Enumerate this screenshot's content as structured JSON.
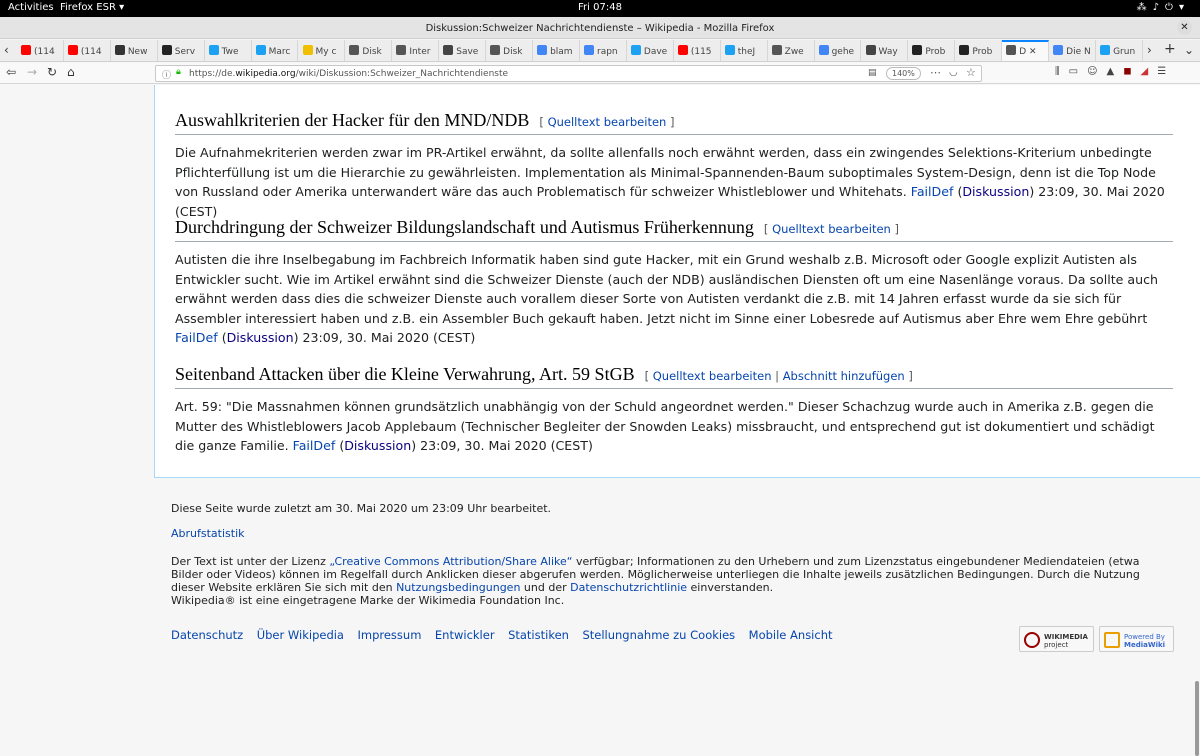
{
  "system": {
    "activities": "Activities",
    "app_name": "Firefox ESR ▾",
    "clock": "Fri 07:48"
  },
  "window": {
    "title": "Diskussion:Schweizer Nachrichtendienste – Wikipedia - Mozilla Firefox"
  },
  "tabs": [
    {
      "label": "(114",
      "color": "#ff0000"
    },
    {
      "label": "(114",
      "color": "#ff0000"
    },
    {
      "label": "New",
      "color": "#333333"
    },
    {
      "label": "Serv",
      "color": "#222222"
    },
    {
      "label": "Twe",
      "color": "#1da1f2"
    },
    {
      "label": "Marc",
      "color": "#1da1f2"
    },
    {
      "label": "My c",
      "color": "#f0c000"
    },
    {
      "label": "Disk",
      "color": "#555555"
    },
    {
      "label": "Inter",
      "color": "#555555"
    },
    {
      "label": "Save",
      "color": "#444444"
    },
    {
      "label": "Disk",
      "color": "#555555"
    },
    {
      "label": "blam",
      "color": "#4285f4"
    },
    {
      "label": "rapn",
      "color": "#4285f4"
    },
    {
      "label": "Dave",
      "color": "#1da1f2"
    },
    {
      "label": "(115",
      "color": "#ff0000"
    },
    {
      "label": "theJ",
      "color": "#1da1f2"
    },
    {
      "label": "Zwe",
      "color": "#555555"
    },
    {
      "label": "gehe",
      "color": "#4285f4"
    },
    {
      "label": "Way",
      "color": "#444444"
    },
    {
      "label": "Prob",
      "color": "#222222"
    },
    {
      "label": "Prob",
      "color": "#222222"
    },
    {
      "label": "D",
      "color": "#555555"
    },
    {
      "label": "Die N",
      "color": "#4285f4"
    },
    {
      "label": "Grun",
      "color": "#1da1f2"
    }
  ],
  "nav": {
    "url_prefix": "https://de.",
    "url_domain": "wikipedia.org",
    "url_path": "/wiki/Diskussion:Schweizer_Nachrichtendienste",
    "zoom": "140%"
  },
  "sections": [
    {
      "heading": "Auswahlkriterien der Hacker für den MND/NDB",
      "edit": "Quelltext bearbeiten",
      "text": "Die Aufnahmekriterien werden zwar im PR-Artikel erwähnt, da sollte allenfalls noch erwähnt werden, dass ein zwingendes Selektions-Kriterium unbedingte Pflichterfüllung ist um die Hierarchie zu gewährleisten. Implementation als Minimal-Spannenden-Baum suboptimales System-Design, denn ist die Top Node von Russland oder Amerika unterwandert wäre das auch Problematisch für schweizer Whistleblower und Whitehats. ",
      "user": "FailDef",
      "talk": "Diskussion",
      "time": " 23:09, 30. Mai 2020 (CEST)"
    },
    {
      "heading": "Durchdringung der Schweizer Bildungslandschaft und Autismus Früherkennung",
      "edit": "Quelltext bearbeiten",
      "text": "Autisten die ihre Inselbegabung im Fachbreich Informatik haben sind gute Hacker, mit ein Grund weshalb z.B. Microsoft oder Google explizit Autisten als Entwickler sucht. Wie im Artikel erwähnt sind die Schweizer Dienste (auch der NDB) ausländischen Diensten oft um eine Nasenlänge voraus. Da sollte auch erwähnt werden dass dies die schweizer Dienste auch vorallem dieser Sorte von Autisten verdankt die z.B. mit 14 Jahren erfasst wurde da sie sich für Assembler interessiert haben und z.B. ein Assembler Buch gekauft haben. Jetzt nicht im Sinne einer Lobesrede auf Autismus aber Ehre wem Ehre gebührt ",
      "user": "FailDef",
      "talk": "Diskussion",
      "time": " 23:09, 30. Mai 2020 (CEST)"
    },
    {
      "heading": "Seitenband Attacken über die Kleine Verwahrung, Art. 59 StGB",
      "edit": "Quelltext bearbeiten",
      "add": "Abschnitt hinzufügen",
      "text": "Art. 59: \"Die Massnahmen können grundsätzlich unabhängig von der Schuld angeordnet werden.\" Dieser Schachzug wurde auch in Amerika z.B. gegen die Mutter des Whistleblowers Jacob Applebaum (Technischer Begleiter der Snowden Leaks) missbraucht, und entsprechend gut ist dokumentiert und schädigt die ganze Familie. ",
      "user": "FailDef",
      "talk": "Diskussion",
      "time": " 23:09, 30. Mai 2020 (CEST)"
    }
  ],
  "footer": {
    "last_edit": "Diese Seite wurde zuletzt am 30. Mai 2020 um 23:09 Uhr bearbeitet.",
    "stats": "Abrufstatistik",
    "license_1": "Der Text ist unter der Lizenz ",
    "license_link": "„Creative Commons Attribution/Share Alike“",
    "license_2": " verfügbar; Informationen zu den Urhebern und zum Lizenzstatus eingebundener Mediendateien (etwa Bilder oder Videos) können im Regelfall durch Anklicken dieser abgerufen werden. Möglicherweise unterliegen die Inhalte jeweils zusätzlichen Bedingungen. Durch die Nutzung dieser Website erklären Sie sich mit den ",
    "terms": "Nutzungsbedingungen",
    "license_3": " und der ",
    "privacy": "Datenschutzrichtlinie",
    "license_4": " einverstanden.",
    "trademark": "Wikipedia® ist eine eingetragene Marke der Wikimedia Foundation Inc.",
    "links": [
      "Datenschutz",
      "Über Wikipedia",
      "Impressum",
      "Entwickler",
      "Statistiken",
      "Stellungnahme zu Cookies",
      "Mobile Ansicht"
    ],
    "badge1_a": "WIKIMEDIA",
    "badge1_b": "project",
    "badge2_a": "Powered By",
    "badge2_b": "MediaWiki"
  }
}
